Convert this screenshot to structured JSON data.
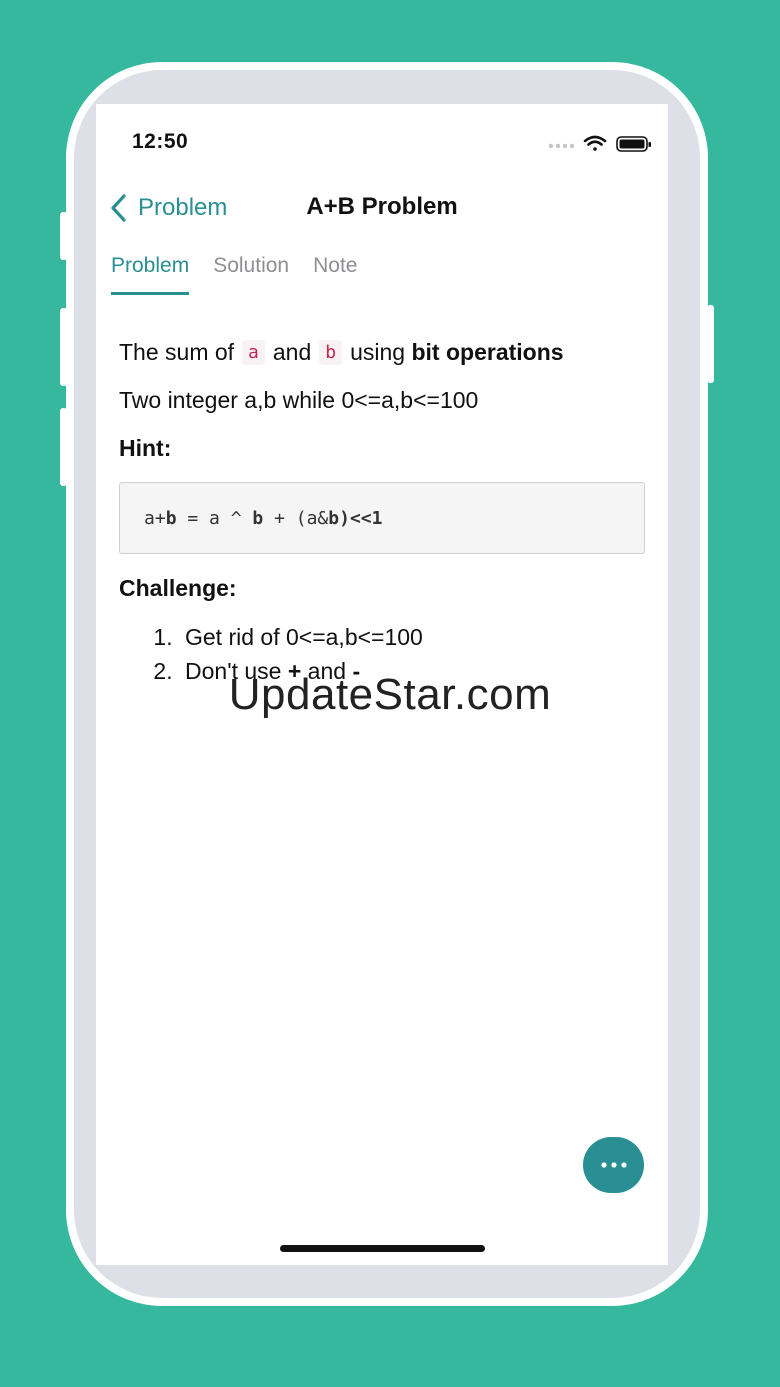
{
  "status_bar": {
    "time": "12:50",
    "icons": [
      "signal-dots-icon",
      "wifi-icon",
      "battery-icon"
    ]
  },
  "nav": {
    "back_label": "Problem",
    "title": "A+B Problem"
  },
  "tabs": [
    {
      "label": "Problem",
      "active": true
    },
    {
      "label": "Solution",
      "active": false
    },
    {
      "label": "Note",
      "active": false
    }
  ],
  "content": {
    "line1": {
      "prefix": "The sum of",
      "code_a": "a",
      "middle": "and",
      "code_b": "b",
      "suffix": "using",
      "bold": "bit operations"
    },
    "line2": "Two integer a,b while 0<=a,b<=100",
    "hint_heading": "Hint:",
    "hint_code": {
      "p1": "a+",
      "p2": "b",
      "p3": " = a ^ ",
      "p4": "b",
      "p5": " + (a&",
      "p6": "b)<<1"
    },
    "challenge_heading": "Challenge:",
    "challenge_items": [
      {
        "text": "Get rid of 0<=a,b<=100"
      },
      {
        "prefix": "Don't use",
        "plus": "+",
        "middle": "and",
        "minus": "-"
      }
    ]
  },
  "watermark": "UpdateStar.com",
  "fab": {
    "icon": "more-horizontal-icon"
  },
  "colors": {
    "background": "#35b89e",
    "accent": "#2a8f93",
    "inline_code": "#c7254e"
  }
}
